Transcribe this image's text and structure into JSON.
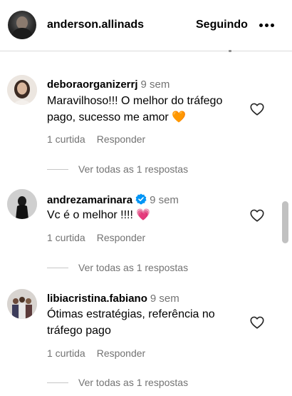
{
  "header": {
    "username": "anderson.allinads",
    "follow_label": "Seguindo",
    "more_icon": "more-horizontal-icon"
  },
  "comments": [
    {
      "username": "deboraorganizerrj",
      "time": "9 sem",
      "verified": false,
      "text": "Maravilhoso!!! O melhor do tráfego pago, sucesso me amor 🧡",
      "likes": "1 curtida",
      "reply_label": "Responder",
      "view_replies": "Ver todas as 1 respostas"
    },
    {
      "username": "andrezamarinara",
      "time": "9 sem",
      "verified": true,
      "text": "Vc é o melhor !!!! 💗",
      "likes": "1 curtida",
      "reply_label": "Responder",
      "view_replies": "Ver todas as 1 respostas"
    },
    {
      "username": "libiacristina.fabiano",
      "time": "9 sem",
      "verified": false,
      "text": "Ótimas estratégias, referência no tráfego pago",
      "likes": "1 curtida",
      "reply_label": "Responder",
      "view_replies": "Ver todas as 1 respostas"
    }
  ],
  "colors": {
    "secondary_text": "#737373",
    "verified_blue": "#0095f6",
    "divider": "#dbdbdb"
  }
}
